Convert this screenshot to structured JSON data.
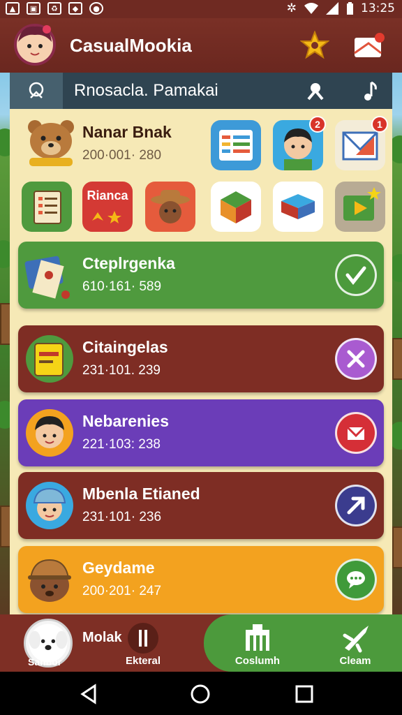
{
  "status_bar": {
    "time": "13:25",
    "icons": [
      "notification-icon",
      "image-icon",
      "recycle-icon",
      "bag-icon",
      "record-icon",
      "bluetooth-icon",
      "wifi-icon",
      "signal-icon",
      "battery-icon"
    ]
  },
  "app_bar": {
    "title": "CasualMookia"
  },
  "search_bar": {
    "text": "Rnosacla. Pamakai"
  },
  "profile": {
    "name": "Nanar Bnak",
    "number": "200·001· 280"
  },
  "tiles_row1": [
    {
      "icon": "spreadsheet-icon",
      "badge": ""
    },
    {
      "icon": "person-avatar-icon",
      "badge": "2"
    },
    {
      "icon": "mail-icon",
      "badge": "1"
    }
  ],
  "tiles_row2": [
    {
      "icon": "checklist-icon",
      "label": ""
    },
    {
      "icon": "rianca-tile",
      "label": "Rianca"
    },
    {
      "icon": "cowboy-icon",
      "label": ""
    },
    {
      "icon": "cube-icon",
      "label": ""
    },
    {
      "icon": "blue-cube-icon",
      "label": ""
    },
    {
      "icon": "play-store-icon",
      "label": ""
    }
  ],
  "cards": [
    {
      "title": "Cteplrgenka",
      "number": "610·161· 589",
      "color": "#4f9a3e",
      "action_color": "#4c9a3c",
      "icon": "map-icon",
      "action_icon": "check-icon"
    },
    {
      "title": "Citaingelas",
      "number": "231·101. 239",
      "color": "#7e2d24",
      "action_color": "#a95bd0",
      "icon": "notebook-icon",
      "action_icon": "tools-icon"
    },
    {
      "title": "Nebarenies",
      "number": "221·103: 238",
      "color": "#6b3db8",
      "action_color": "#d52f37",
      "icon": "boy-avatar-icon",
      "action_icon": "envelope-icon"
    },
    {
      "title": "Mbenla Etianed",
      "number": "231·101· 236",
      "color": "#7e2d24",
      "action_color": "#3b3c8e",
      "icon": "helmet-avatar-icon",
      "action_icon": "send-icon"
    },
    {
      "title": "Geydame",
      "number": "200·201· 247",
      "color": "#f3a21f",
      "action_color": "#3f9a3a",
      "icon": "bear-hat-icon",
      "action_icon": "chat-icon"
    }
  ],
  "bottom_nav": {
    "profile_label": "Sanbor",
    "name": "Molak",
    "items": [
      {
        "label": "Ekteral",
        "icon": "pin-icon"
      },
      {
        "label": "Coslumh",
        "icon": "building-icon"
      },
      {
        "label": "Cleam",
        "icon": "rocket-icon"
      }
    ]
  }
}
